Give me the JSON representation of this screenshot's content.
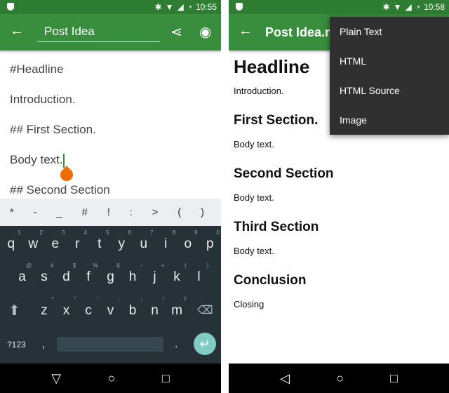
{
  "left": {
    "status": {
      "time": "10:55"
    },
    "toolbar": {
      "title": "Post Idea",
      "icons": [
        "back-arrow-icon",
        "share-icon",
        "eye-icon"
      ]
    },
    "editor": {
      "lines": [
        "#Headline",
        "Introduction.",
        "## First Section.",
        "Body text.",
        "## Second Section"
      ]
    },
    "suggestions": [
      "*",
      "-",
      "_",
      "#",
      "!",
      ":",
      ">",
      "(",
      ")"
    ],
    "keyboard": {
      "row1": [
        [
          "q",
          "1"
        ],
        [
          "w",
          "2"
        ],
        [
          "e",
          "3"
        ],
        [
          "r",
          "4"
        ],
        [
          "t",
          "5"
        ],
        [
          "y",
          "6"
        ],
        [
          "u",
          "7"
        ],
        [
          "i",
          "8"
        ],
        [
          "o",
          "9"
        ],
        [
          "p",
          "0"
        ]
      ],
      "row2": [
        [
          "a",
          "@"
        ],
        [
          "s",
          "#"
        ],
        [
          "d",
          "$"
        ],
        [
          "f",
          "%"
        ],
        [
          "g",
          "&"
        ],
        [
          "h",
          "-"
        ],
        [
          "j",
          "+"
        ],
        [
          "k",
          "("
        ],
        [
          "l",
          ")"
        ]
      ],
      "row3": [
        [
          "z",
          "*"
        ],
        [
          "x",
          "\""
        ],
        [
          "c",
          "'"
        ],
        [
          "v",
          ":"
        ],
        [
          "b",
          ";"
        ],
        [
          "n",
          "!"
        ],
        [
          "m",
          "?"
        ]
      ],
      "symbols": "?123",
      "comma": ",",
      "period": ".",
      "enter_color": "#80cbc4"
    }
  },
  "right": {
    "status": {
      "time": "10:58"
    },
    "toolbar": {
      "title": "Post Idea.md"
    },
    "preview": {
      "h1": "Headline",
      "intro": "Introduction.",
      "s1": "First Section.",
      "s2": "Second Section",
      "s3": "Third Section",
      "body": "Body text.",
      "conclusion": "Conclusion",
      "closing": "Closing"
    },
    "menu": [
      "Plain Text",
      "HTML",
      "HTML Source",
      "Image"
    ]
  },
  "colors": {
    "status": "#2e7d32",
    "toolbar": "#388e3c",
    "keyboard": "#263238",
    "menu": "#303030",
    "handle": "#ef6c00"
  }
}
